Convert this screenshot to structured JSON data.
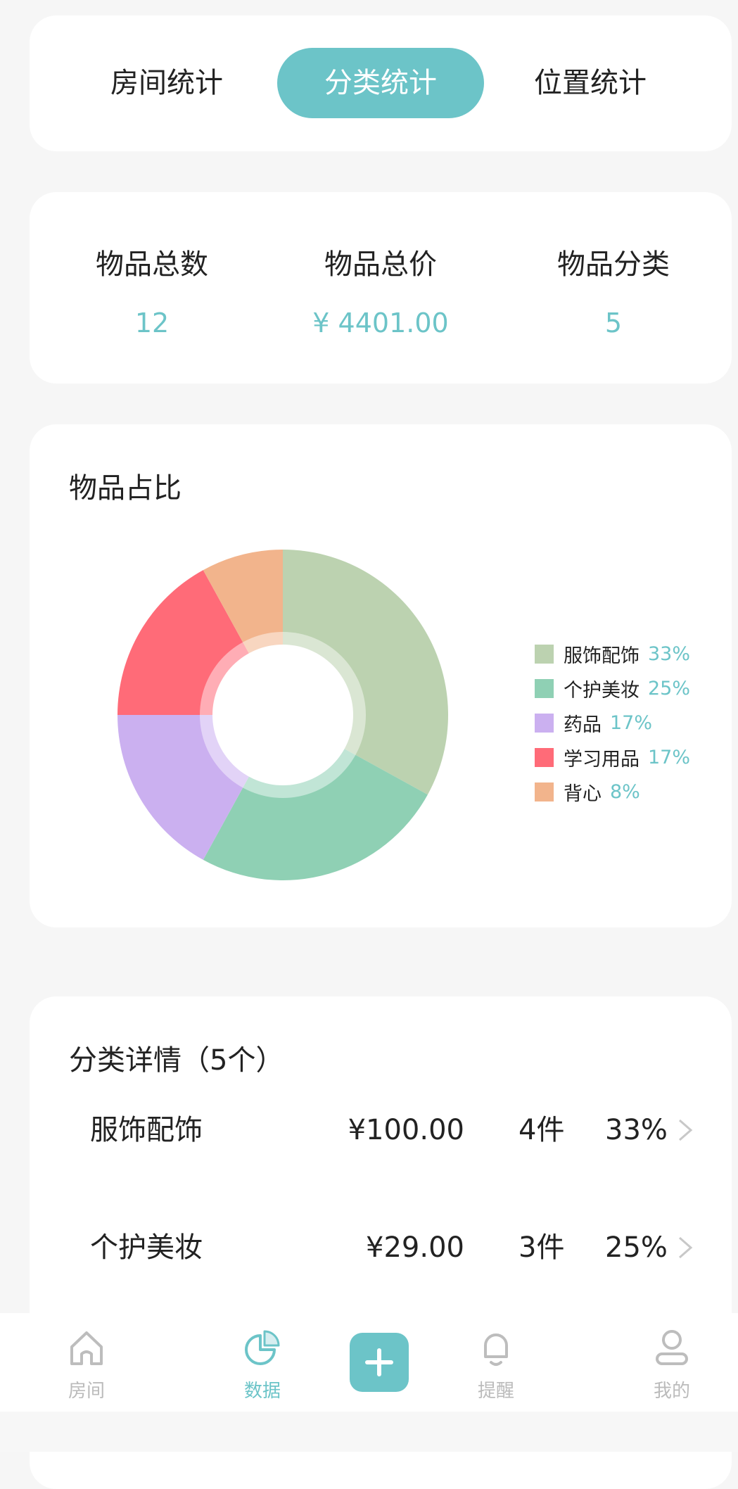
{
  "tabs": [
    {
      "label": "房间统计",
      "active": false
    },
    {
      "label": "分类统计",
      "active": true
    },
    {
      "label": "位置统计",
      "active": false
    }
  ],
  "stats": [
    {
      "label": "物品总数",
      "value": "12"
    },
    {
      "label": "物品总价",
      "value": "¥ 4401.00"
    },
    {
      "label": "物品分类",
      "value": "5"
    }
  ],
  "chart_section": {
    "title": "物品占比"
  },
  "chart_data": {
    "type": "pie",
    "donut": true,
    "series": [
      {
        "name": "服饰配饰",
        "pct_label": "33%",
        "value": 33,
        "color": "#bcd2b0"
      },
      {
        "name": "个护美妆",
        "pct_label": "25%",
        "value": 25,
        "color": "#8fd0b4"
      },
      {
        "name": "药品",
        "pct_label": "17%",
        "value": 17,
        "color": "#cbb0f0"
      },
      {
        "name": "学习用品",
        "pct_label": "17%",
        "value": 17,
        "color": "#ff6b78"
      },
      {
        "name": "背心",
        "pct_label": "8%",
        "value": 8,
        "color": "#f2b48c"
      }
    ],
    "legend_position": "right"
  },
  "detail": {
    "title": "分类详情（5个）",
    "rows": [
      {
        "name": "服饰配饰",
        "price": "¥100.00",
        "count": "4件",
        "pct": "33%"
      },
      {
        "name": "个护美妆",
        "price": "¥29.00",
        "count": "3件",
        "pct": "25%"
      }
    ]
  },
  "nav": {
    "items": [
      {
        "label": "房间",
        "icon": "home-icon",
        "active": false
      },
      {
        "label": "数据",
        "icon": "pie-chart-icon",
        "active": true
      },
      {
        "label": "提醒",
        "icon": "bell-icon",
        "active": false
      },
      {
        "label": "我的",
        "icon": "profile-icon",
        "active": false
      }
    ],
    "add_icon": "plus-icon"
  },
  "colors": {
    "accent": "#6cc4c8",
    "background": "#f6f6f6"
  }
}
